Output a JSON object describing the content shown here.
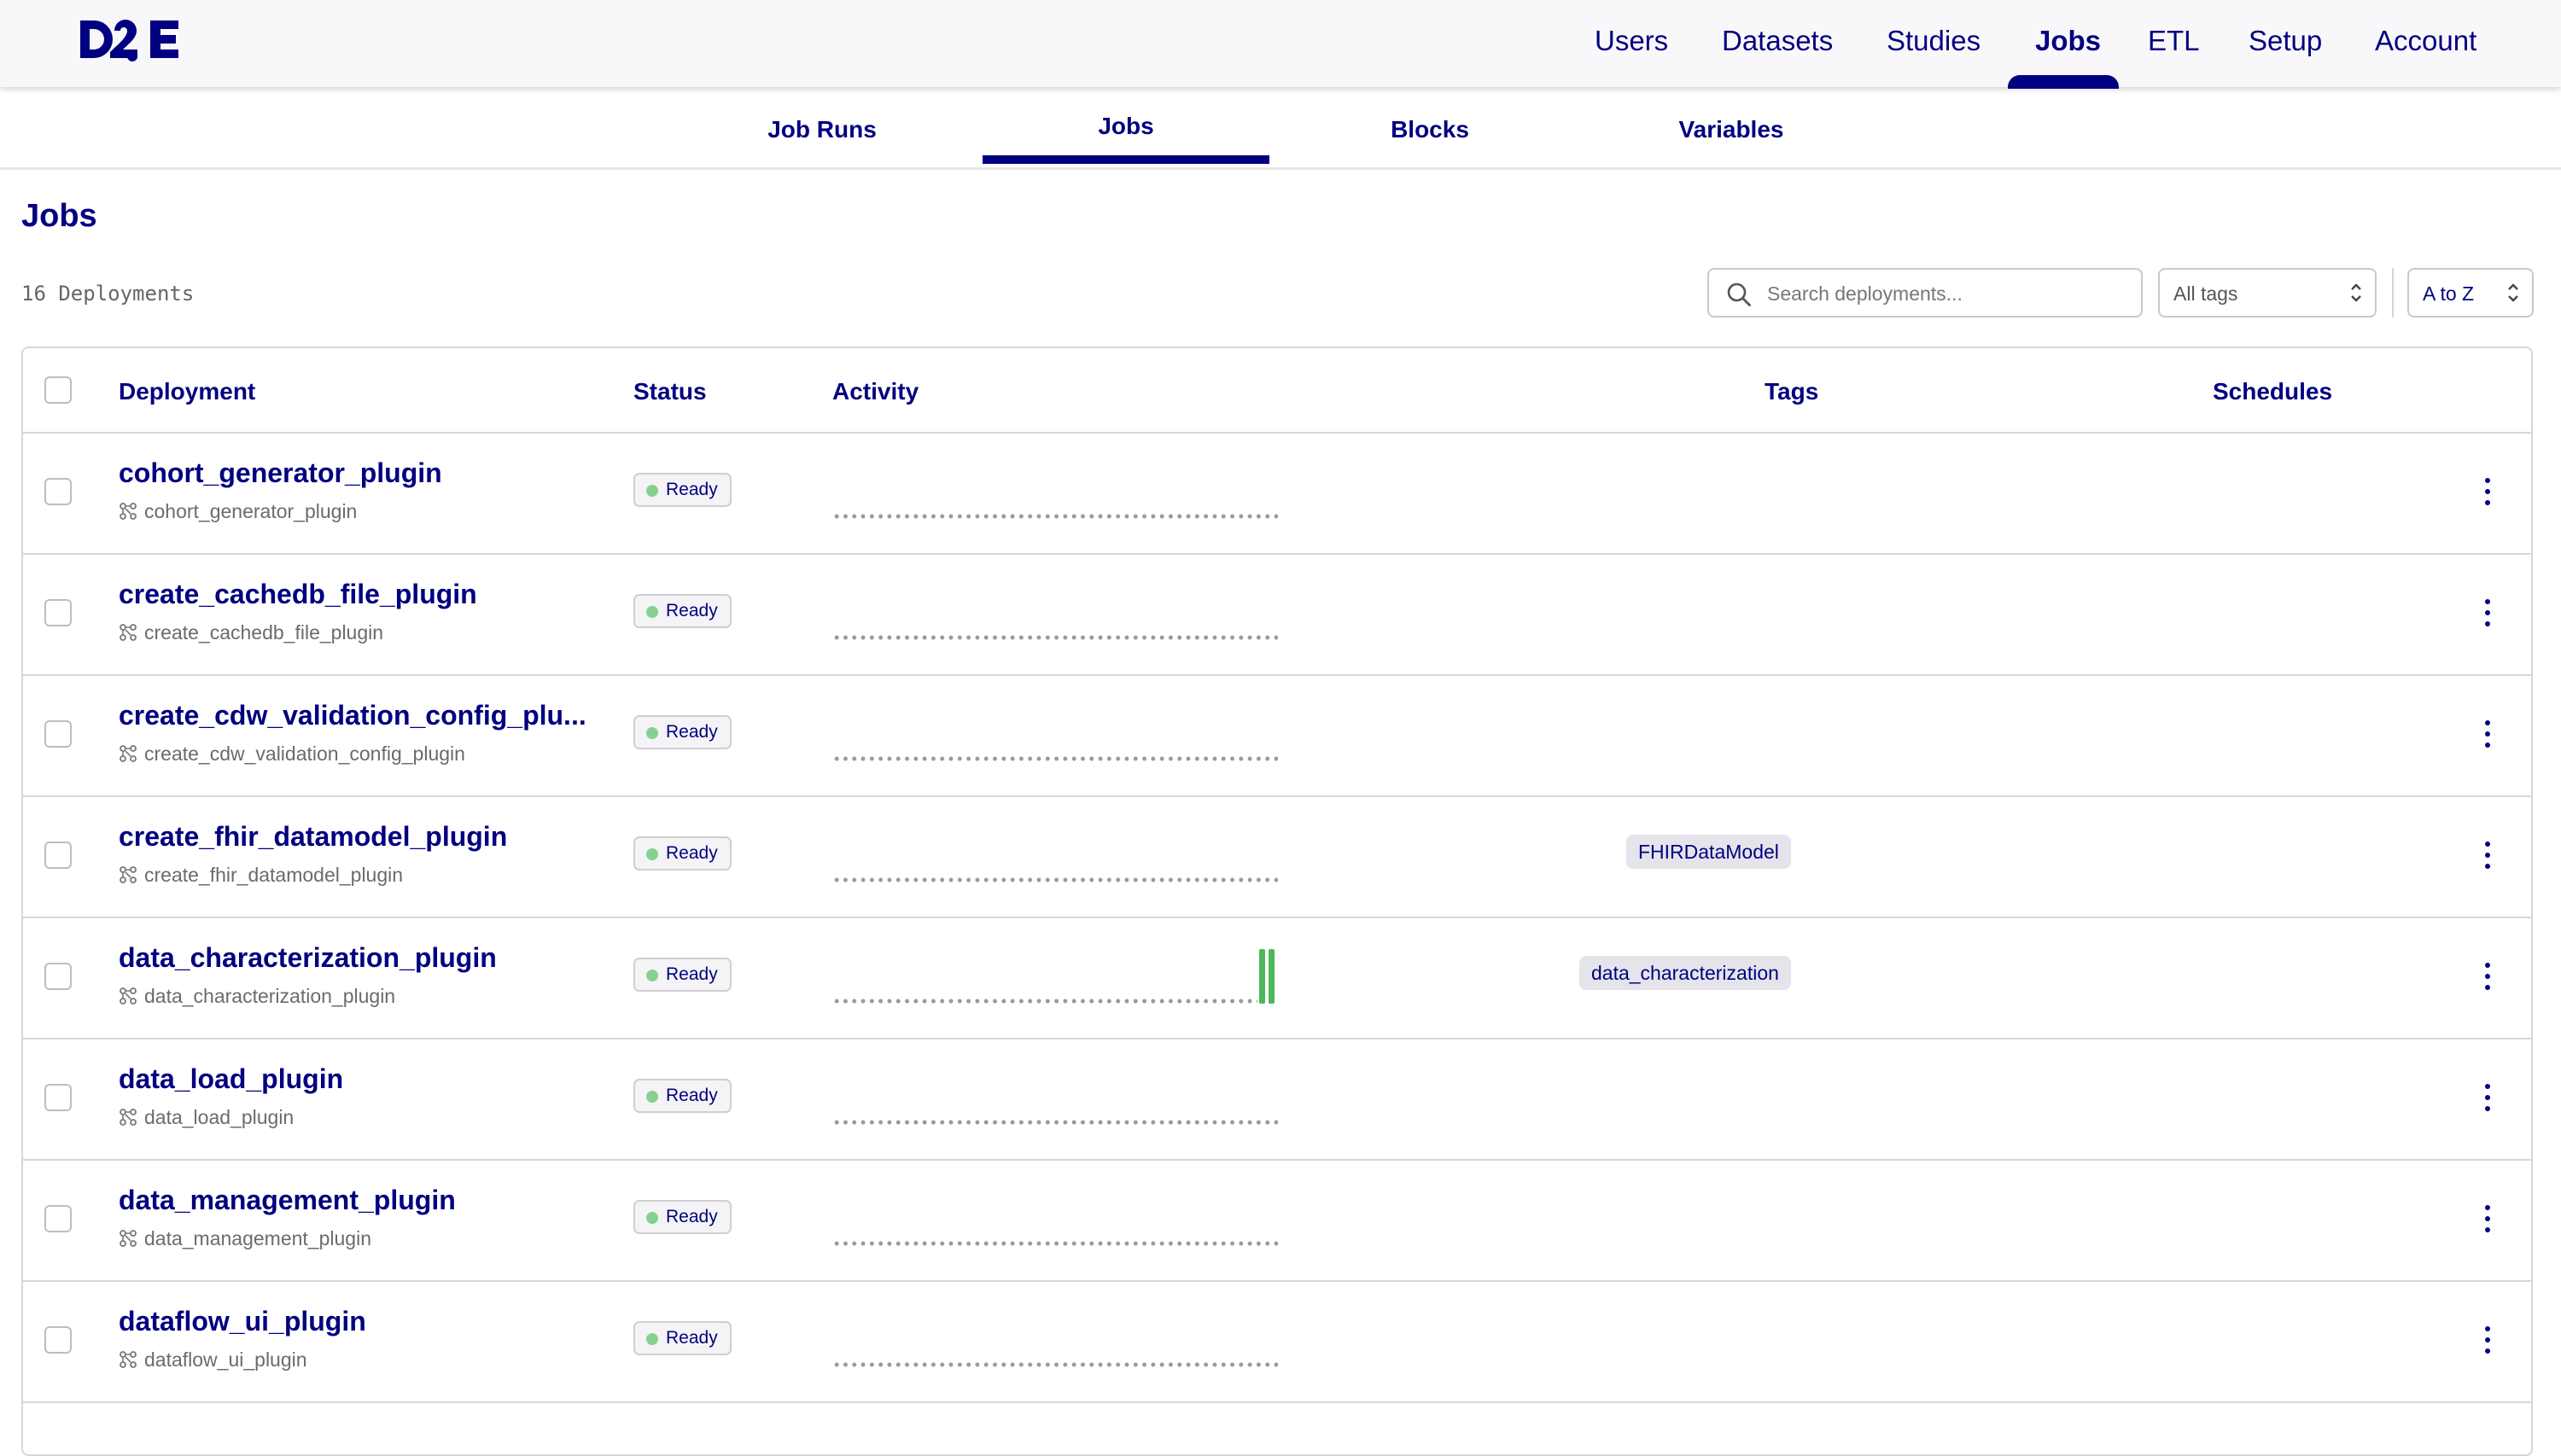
{
  "app": {
    "logo_text": "D2E"
  },
  "nav": {
    "items": [
      "Users",
      "Datasets",
      "Studies",
      "Jobs",
      "ETL",
      "Setup",
      "Account"
    ],
    "active": "Jobs"
  },
  "subtabs": {
    "items": [
      "Job Runs",
      "Jobs",
      "Blocks",
      "Variables"
    ],
    "active": "Jobs"
  },
  "page": {
    "title": "Jobs",
    "deployment_count": "16 Deployments"
  },
  "filters": {
    "search_placeholder": "Search deployments...",
    "tags_select": "All tags",
    "sort_select": "A to Z"
  },
  "table": {
    "columns": {
      "deployment": "Deployment",
      "status": "Status",
      "activity": "Activity",
      "tags": "Tags",
      "schedules": "Schedules"
    },
    "rows": [
      {
        "name": "cohort_generator_plugin",
        "flow": "cohort_generator_plugin",
        "status": "Ready",
        "tags": []
      },
      {
        "name": "create_cachedb_file_plugin",
        "flow": "create_cachedb_file_plugin",
        "status": "Ready",
        "tags": []
      },
      {
        "name": "create_cdw_validation_config_plu...",
        "flow": "create_cdw_validation_config_plugin",
        "status": "Ready",
        "tags": []
      },
      {
        "name": "create_fhir_datamodel_plugin",
        "flow": "create_fhir_datamodel_plugin",
        "status": "Ready",
        "tags": [
          "FHIRDataModel"
        ]
      },
      {
        "name": "data_characterization_plugin",
        "flow": "data_characterization_plugin",
        "status": "Ready",
        "tags": [
          "data_characterization"
        ],
        "recent_runs": 2
      },
      {
        "name": "data_load_plugin",
        "flow": "data_load_plugin",
        "status": "Ready",
        "tags": []
      },
      {
        "name": "data_management_plugin",
        "flow": "data_management_plugin",
        "status": "Ready",
        "tags": []
      },
      {
        "name": "dataflow_ui_plugin",
        "flow": "dataflow_ui_plugin",
        "status": "Ready",
        "tags": []
      }
    ]
  },
  "colors": {
    "brand": "#000080",
    "ready_dot": "#86d18f",
    "activity_run": "#4cb85c",
    "tag_bg": "#e4e4ea"
  }
}
